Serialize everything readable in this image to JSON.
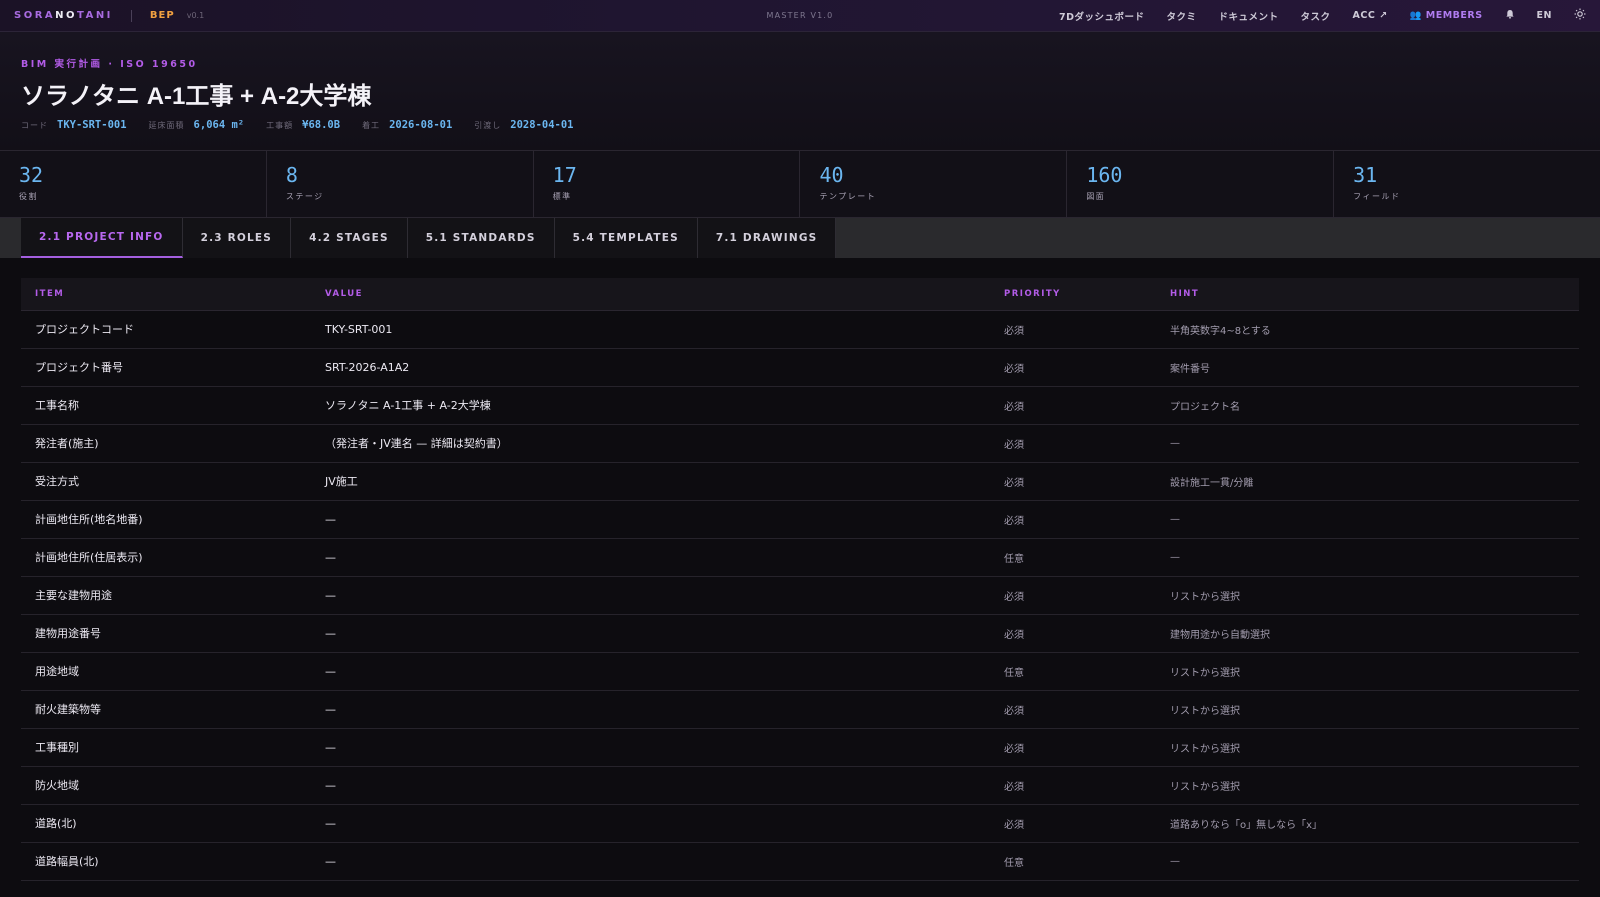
{
  "topbar": {
    "brand_a": "SORA",
    "brand_b": "NO",
    "brand_c": "TANI",
    "app": "BEP",
    "version": "v0.1",
    "master": "MASTER V1.0",
    "nav": [
      "7Dダッシュボード",
      "タクミ",
      "ドキュメント",
      "タスク",
      "ACC ↗"
    ],
    "members": "👥 MEMBERS",
    "lang": "EN",
    "icons": [
      "bell-icon",
      "sun-icon"
    ]
  },
  "header": {
    "eyebrow": "BIM 実行計画 · ISO 19650",
    "title": "ソラノタニ A-1工事 + A-2大学棟",
    "meta": [
      {
        "label": "コード",
        "value": "TKY-SRT-001"
      },
      {
        "label": "延床面積",
        "value": "6,064 m²"
      },
      {
        "label": "工事額",
        "value": "¥68.0B"
      },
      {
        "label": "着工",
        "value": "2026-08-01"
      },
      {
        "label": "引渡し",
        "value": "2028-04-01"
      }
    ]
  },
  "stats": [
    {
      "num": "32",
      "label": "役割"
    },
    {
      "num": "8",
      "label": "ステージ"
    },
    {
      "num": "17",
      "label": "標準"
    },
    {
      "num": "40",
      "label": "テンプレート"
    },
    {
      "num": "160",
      "label": "図面"
    },
    {
      "num": "31",
      "label": "フィールド"
    }
  ],
  "tabs": [
    "2.1 PROJECT INFO",
    "2.3 ROLES",
    "4.2 STAGES",
    "5.1 STANDARDS",
    "5.4 TEMPLATES",
    "7.1 DRAWINGS"
  ],
  "table": {
    "headers": [
      "ITEM",
      "VALUE",
      "PRIORITY",
      "HINT"
    ],
    "rows": [
      [
        "プロジェクトコード",
        "TKY-SRT-001",
        "必須",
        "半角英数字4~8とする"
      ],
      [
        "プロジェクト番号",
        "SRT-2026-A1A2",
        "必須",
        "案件番号"
      ],
      [
        "工事名称",
        "ソラノタニ A-1工事 + A-2大学棟",
        "必須",
        "プロジェクト名"
      ],
      [
        "発注者(施主)",
        "（発注者・JV連名 — 詳細は契約書）",
        "必須",
        "—"
      ],
      [
        "受注方式",
        "JV施工",
        "必須",
        "設計施工一貫/分離"
      ],
      [
        "計画地住所(地名地番)",
        "—",
        "必須",
        "—"
      ],
      [
        "計画地住所(住居表示)",
        "—",
        "任意",
        "—"
      ],
      [
        "主要な建物用途",
        "—",
        "必須",
        "リストから選択"
      ],
      [
        "建物用途番号",
        "—",
        "必須",
        "建物用途から自動選択"
      ],
      [
        "用途地域",
        "—",
        "任意",
        "リストから選択"
      ],
      [
        "耐火建築物等",
        "—",
        "必須",
        "リストから選択"
      ],
      [
        "工事種別",
        "—",
        "必須",
        "リストから選択"
      ],
      [
        "防火地域",
        "—",
        "必須",
        "リストから選択"
      ],
      [
        "道路(北)",
        "—",
        "必須",
        "道路ありなら「o」無しなら「x」"
      ],
      [
        "道路幅員(北)",
        "—",
        "任意",
        "—"
      ]
    ]
  },
  "colors": {
    "accent": "#b35ce8",
    "link": "#6bb6f0",
    "brand_app": "#f0a040"
  }
}
